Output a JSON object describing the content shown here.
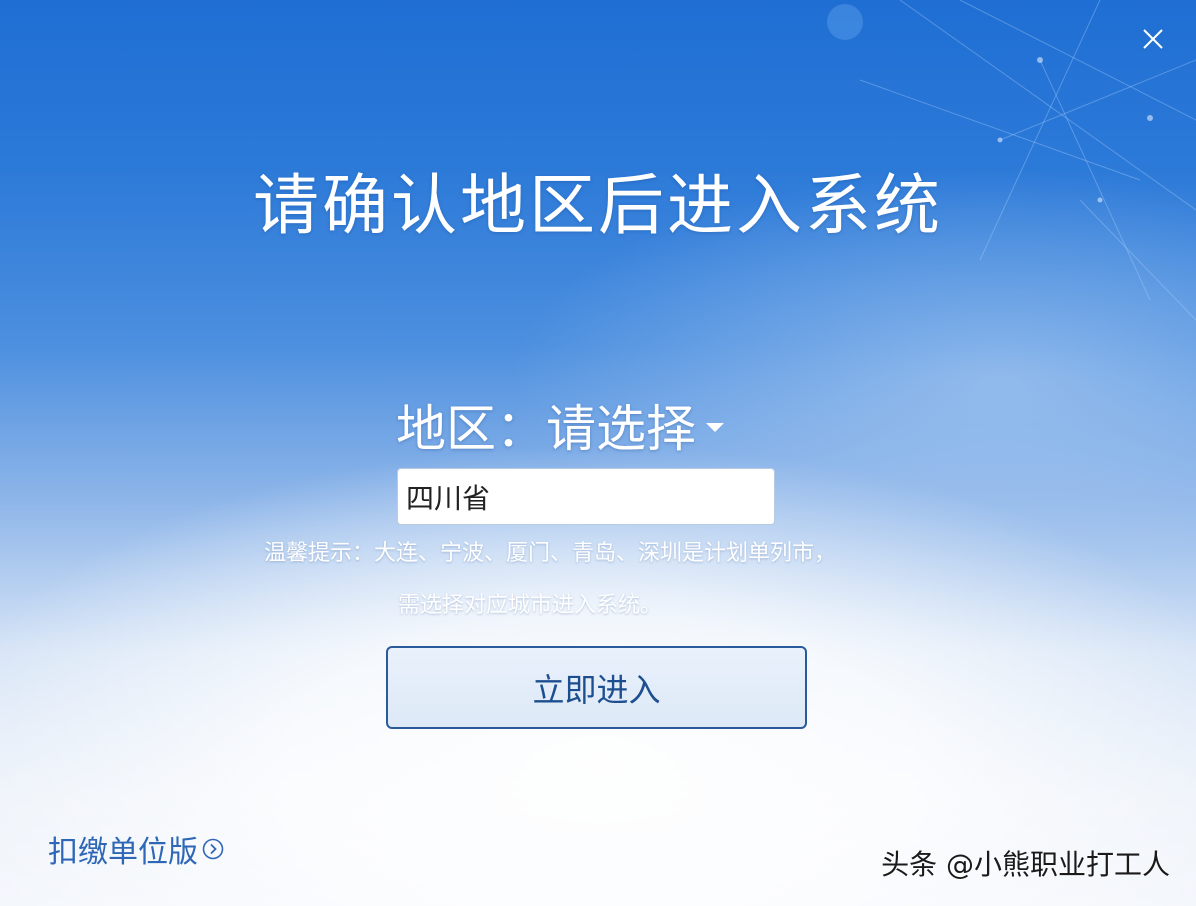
{
  "window": {
    "title": "请确认地区后进入系统",
    "close_icon": "close-icon"
  },
  "region": {
    "label": "地区：",
    "select_placeholder": "请选择",
    "caret_icon": "caret-down-icon",
    "province_value": "四川省"
  },
  "tip": {
    "line1": "温馨提示：大连、宁波、厦门、青岛、深圳是计划单列市，",
    "line2": "需选择对应城市进入系统。"
  },
  "actions": {
    "enter_label": "立即进入",
    "unit_version_label": "扣缴单位版",
    "unit_version_icon": "circle-chevron-right-icon"
  },
  "watermark": {
    "text": "头条 @小熊职业打工人"
  },
  "colors": {
    "accent_dark": "#2b5a9b",
    "link": "#2f67b7",
    "bg_top": "#1f6ed3"
  }
}
